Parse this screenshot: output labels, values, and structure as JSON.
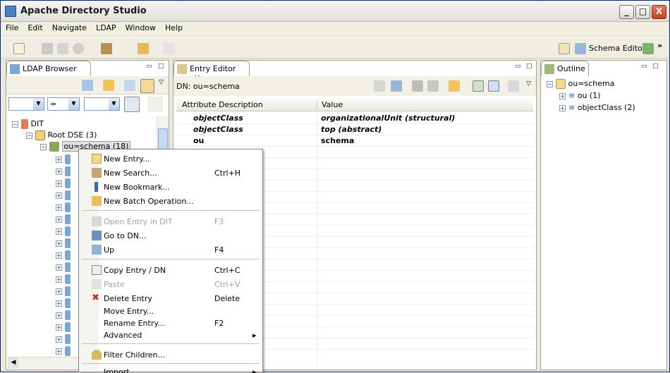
{
  "window": {
    "title": "Apache Directory Studio"
  },
  "window_controls": {
    "minimize": "_",
    "maximize": "□",
    "close": "X"
  },
  "menu": [
    "File",
    "Edit",
    "Navigate",
    "LDAP",
    "Window",
    "Help"
  ],
  "toolbar": {
    "perspective_label": "Schema Editor",
    "more": "»"
  },
  "ldap_browser": {
    "tab_label": "LDAP Browser",
    "filter": {
      "attr_value": "",
      "operator": "=",
      "value": ""
    },
    "tree": [
      {
        "label": "DIT",
        "level": 0,
        "expander": "−"
      },
      {
        "label": "Root DSE (3)",
        "level": 1,
        "expander": "−"
      },
      {
        "label": "ou=schema (18)",
        "level": 2,
        "expander": "−",
        "selected": true
      }
    ]
  },
  "entry_editor": {
    "tab_label": "Entry Editor",
    "tab_close": "✕",
    "dn_label": "DN: ou=schema",
    "columns": [
      "Attribute Description",
      "Value"
    ],
    "rows": [
      {
        "attr": "objectClass",
        "value": "organizationalUnit (structural)",
        "style": "italic-bold"
      },
      {
        "attr": "objectClass",
        "value": "top (abstract)",
        "style": "italic-bold"
      },
      {
        "attr": "ou",
        "value": "schema",
        "style": "bold"
      }
    ]
  },
  "outline": {
    "tab_label": "Outline",
    "root": "ou=schema",
    "children": [
      "ou (1)",
      "objectClass (2)"
    ]
  },
  "context_menu": {
    "items": [
      {
        "label": "New Entry...",
        "accel": "",
        "icon": "new-entry-icon",
        "disabled": false
      },
      {
        "label": "New Search...",
        "accel": "Ctrl+H",
        "icon": "new-search-icon",
        "disabled": false
      },
      {
        "label": "New Bookmark...",
        "accel": "",
        "icon": "new-bookmark-icon",
        "disabled": false
      },
      {
        "label": "New Batch Operation...",
        "accel": "",
        "icon": "batch-operation-icon",
        "disabled": false
      },
      {
        "label": "Open Entry in DIT",
        "accel": "F3",
        "icon": "open-entry-icon",
        "disabled": true
      },
      {
        "label": "Go to DN...",
        "accel": "",
        "icon": "goto-dn-icon",
        "disabled": false
      },
      {
        "label": "Up",
        "accel": "F4",
        "icon": "up-icon",
        "disabled": false
      },
      {
        "label": "Copy Entry / DN",
        "accel": "Ctrl+C",
        "icon": "copy-icon",
        "disabled": false
      },
      {
        "label": "Paste",
        "accel": "Ctrl+V",
        "icon": "paste-icon",
        "disabled": true
      },
      {
        "label": "Delete Entry",
        "accel": "Delete",
        "icon": "delete-icon",
        "disabled": false
      },
      {
        "label": "Move Entry...",
        "accel": "",
        "icon": "",
        "disabled": false
      },
      {
        "label": "Rename Entry...",
        "accel": "F2",
        "icon": "",
        "disabled": false
      },
      {
        "label": "Advanced",
        "accel": "▸",
        "icon": "",
        "disabled": false
      },
      {
        "label": "Filter Children...",
        "accel": "",
        "icon": "filter-icon",
        "disabled": false
      },
      {
        "label": "Import",
        "accel": "▸",
        "icon": "",
        "disabled": false
      }
    ]
  }
}
